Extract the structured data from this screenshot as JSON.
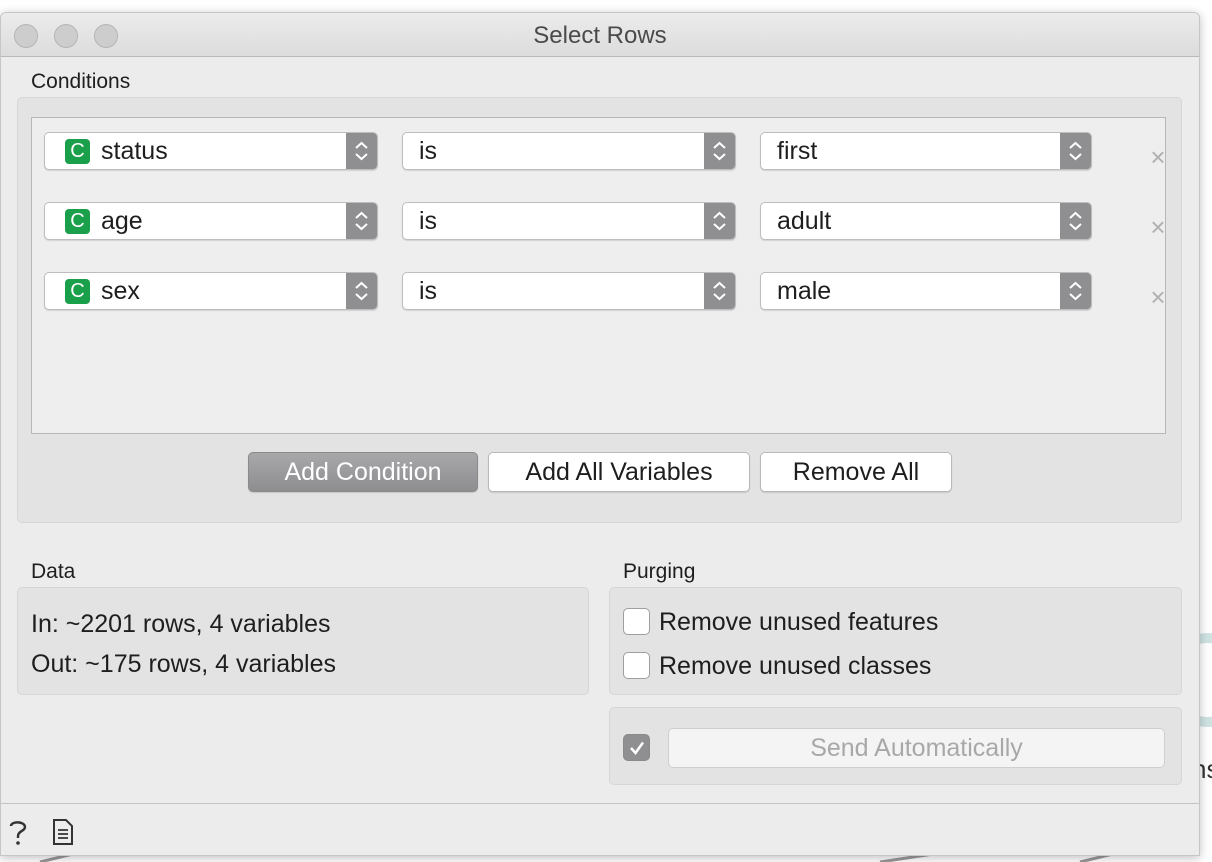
{
  "window": {
    "title": "Select Rows"
  },
  "conditions": {
    "label": "Conditions",
    "rows": [
      {
        "variable": "status",
        "badge": "C",
        "operator": "is",
        "value": "first",
        "remove": "×"
      },
      {
        "variable": "age",
        "badge": "C",
        "operator": "is",
        "value": "adult",
        "remove": "×"
      },
      {
        "variable": "sex",
        "badge": "C",
        "operator": "is",
        "value": "male",
        "remove": "×"
      }
    ],
    "add_condition": "Add Condition",
    "add_all": "Add All Variables",
    "remove_all": "Remove All"
  },
  "data": {
    "label": "Data",
    "in_line": "In: ~2201 rows, 4 variables",
    "out_line": "Out: ~175 rows, 4 variables"
  },
  "purging": {
    "label": "Purging",
    "remove_features": "Remove unused features",
    "remove_features_checked": false,
    "remove_classes": "Remove unused classes",
    "remove_classes_checked": false
  },
  "commit": {
    "auto_checked": true,
    "send_label": "Send Automatically"
  },
  "background_partial_text": "ns",
  "statusbar": {
    "help_icon": "help-icon",
    "report_icon": "report-icon"
  },
  "colors": {
    "badge": "#1aa04a",
    "stepper": "#8f8f92",
    "pressed_button": "#9b9b9e"
  }
}
